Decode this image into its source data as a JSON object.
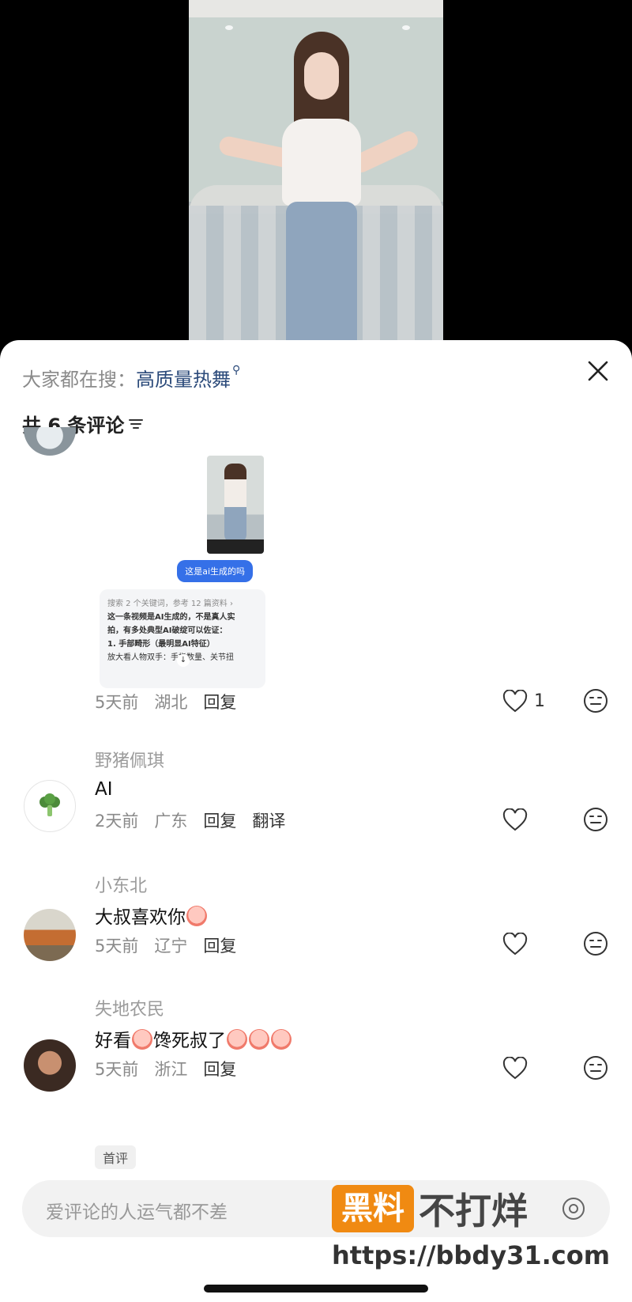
{
  "search_bar": {
    "prefix": "大家都在搜：",
    "keyword": "高质量热舞"
  },
  "comments_header": {
    "count_label": "共 6 条评论"
  },
  "comments": [
    {
      "thumbnail": {
        "question_bubble": "这是ai生成的吗",
        "card_meta": "搜索 2 个关键词，参考 12 篇资料 ›",
        "card_line1": "这一条视频是AI生成的，不是真人实",
        "card_line2": "拍，有多处典型AI破绽可以佐证：",
        "card_line3": "1. 手部畸形（最明显AI特征）",
        "card_line4": "放大看人物双手：手指数量、关节扭"
      },
      "meta": {
        "time": "5天前",
        "location": "湖北",
        "reply": "回复"
      },
      "like_count": "1"
    },
    {
      "name": "野猪佩琪",
      "text": "AI",
      "meta": {
        "time": "2天前",
        "location": "广东",
        "reply": "回复",
        "translate": "翻译"
      }
    },
    {
      "name": "小东北",
      "text": "大叔喜欢你",
      "meta": {
        "time": "5天前",
        "location": "辽宁",
        "reply": "回复"
      }
    },
    {
      "name": "失地农民",
      "text_a": "好看",
      "text_b": "馋死叔了",
      "meta": {
        "time": "5天前",
        "location": "浙江",
        "reply": "回复"
      },
      "badge": "首评"
    }
  ],
  "input": {
    "placeholder": "爱评论的人运气都不差"
  },
  "watermark": {
    "box": "黑料",
    "text": "不打烊",
    "url": "https://bbdy31.com"
  },
  "colors": {
    "keyword": "#2b4a7a",
    "bubble": "#3570e8",
    "watermark": "#f08a12"
  }
}
